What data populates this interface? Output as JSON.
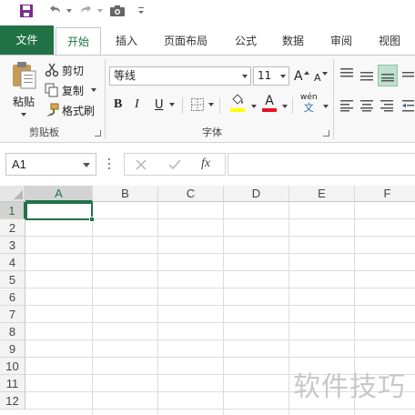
{
  "qat": {
    "icons": [
      "save-icon",
      "undo-icon",
      "redo-icon",
      "camera-icon",
      "customize-qat-icon"
    ]
  },
  "tabs": [
    {
      "label": "文件"
    },
    {
      "label": "开始"
    },
    {
      "label": "插入"
    },
    {
      "label": "页面布局"
    },
    {
      "label": "公式"
    },
    {
      "label": "数据"
    },
    {
      "label": "审阅"
    },
    {
      "label": "视图"
    }
  ],
  "ribbon": {
    "clipboard": {
      "paste_label": "粘贴",
      "cut_label": "剪切",
      "copy_label": "复制",
      "format_painter_label": "格式刷",
      "group_label": "剪贴板"
    },
    "font": {
      "font_name": "等线",
      "font_size": "11",
      "grow_label": "A",
      "shrink_label": "A",
      "bold_label": "B",
      "italic_label": "I",
      "underline_label": "U",
      "font_color_label": "A",
      "phonetic_label": "wén",
      "phonetic_sub": "文",
      "group_label": "字体"
    },
    "colors": {
      "brand": "#217346",
      "highlight": "#ffff00",
      "font_color": "#e81123"
    }
  },
  "formula_bar": {
    "name_box": "A1",
    "fx_label": "fx",
    "value": ""
  },
  "sheet": {
    "columns": [
      "A",
      "B",
      "C",
      "D",
      "E",
      "F"
    ],
    "rows": [
      "1",
      "2",
      "3",
      "4",
      "5",
      "6",
      "7",
      "8",
      "9",
      "10",
      "11",
      "12"
    ],
    "selected_cell": "A1"
  },
  "watermark": "软件技巧"
}
